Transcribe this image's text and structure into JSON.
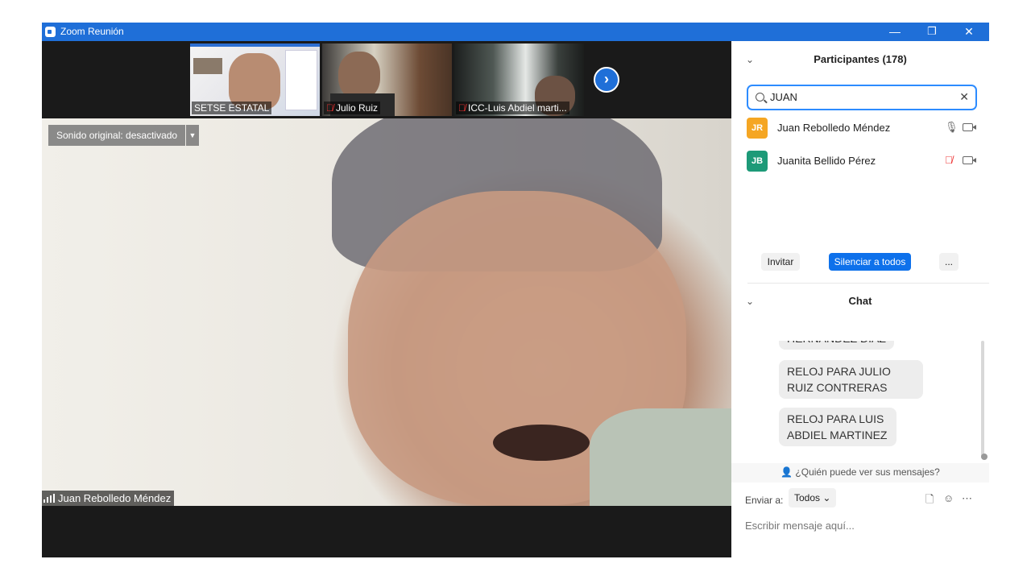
{
  "window": {
    "title": "Zoom Reunión",
    "minimize": "—",
    "restore": "❐",
    "close": "✕"
  },
  "thumbnails": [
    {
      "name": "SETSE ESTATAL",
      "muted": false
    },
    {
      "name": "Julio Ruiz",
      "muted": true
    },
    {
      "name": "ICC-Luis Abdiel marti...",
      "muted": true
    }
  ],
  "next_icon": "chevron-right-icon",
  "main_video": {
    "sound_button": "Sonido original: desactivado",
    "speaker": "Juan Rebolledo Méndez"
  },
  "participants_panel": {
    "title": "Participantes (178)",
    "search_value": "JUAN",
    "items": [
      {
        "initials": "JR",
        "name": "Juan Rebolledo Méndez",
        "color": "#f5a623",
        "mic": "on"
      },
      {
        "initials": "JB",
        "name": "Juanita Bellido Pérez",
        "color": "#1d9a78",
        "mic": "muted"
      }
    ],
    "invite": "Invitar",
    "mute_all": "Silenciar a todos",
    "more": "..."
  },
  "chat": {
    "title": "Chat",
    "messages": [
      "HERNANDEZ DIAZ",
      "RELOJ PARA JULIO RUIZ CONTRERAS",
      "RELOJ PARA LUIS ABDIEL MARTINEZ"
    ],
    "who_can_see": "¿Quién puede ver sus mensajes?",
    "send_to_label": "Enviar a:",
    "send_to_value": "Todos",
    "placeholder": "Escribir mensaje aquí..."
  },
  "colors": {
    "titlebar": "#1f6fd8",
    "accent": "#0e71eb",
    "muted": "#e33333"
  }
}
